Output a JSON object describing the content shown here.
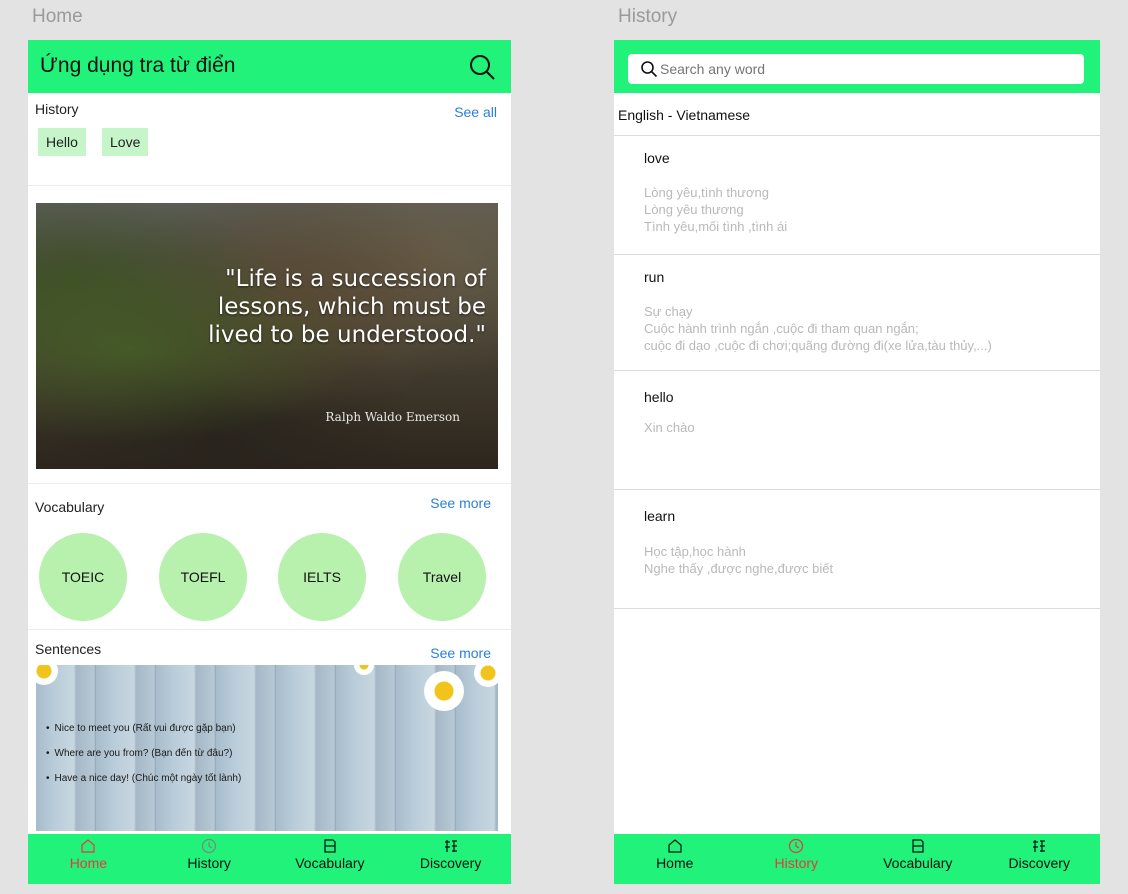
{
  "home": {
    "screen_label": "Home",
    "app_title": "Ứng dụng tra từ điển",
    "history": {
      "title": "History",
      "see_all": "See all",
      "chips": [
        "Hello",
        "Love"
      ]
    },
    "quote": {
      "text": "\"Life is a succession of lessons, which must be lived to be understood.\"",
      "author": "Ralph Waldo Emerson"
    },
    "vocabulary": {
      "title": "Vocabulary",
      "see_more": "See more",
      "items": [
        "TOEIC",
        "TOEFL",
        "IELTS",
        "Travel"
      ]
    },
    "sentences": {
      "title": "Sentences",
      "see_more": "See more",
      "items": [
        "Nice to meet you (Rất vui được gặp bạn)",
        "Where are you from? (Bạn đến từ đâu?)",
        "Have a nice day! (Chúc một ngày tốt lành)"
      ]
    }
  },
  "history_screen": {
    "screen_label": "History",
    "search_placeholder": "Search any word",
    "language": "English - Vietnamese",
    "entries": [
      {
        "word": "love",
        "defs": [
          "Lòng yêu,tình thương",
          "Lòng yêu thương",
          "Tình yêu,mối tình ,tình ái"
        ]
      },
      {
        "word": "run",
        "defs": [
          "Sự chạy",
          "Cuộc hành trình ngắn ,cuộc đi tham quan ngắn;",
          "cuộc đi dạo ,cuộc đi chơi;quãng đường đi(xe lửa,tàu thủy,...)"
        ]
      },
      {
        "word": "hello",
        "defs": [
          "Xin chào"
        ]
      },
      {
        "word": "learn",
        "defs": [
          "Học tập,học hành",
          "Nghe thấy ,được nghe,được biết"
        ]
      }
    ]
  },
  "nav": {
    "items": [
      "Home",
      "History",
      "Vocabulary",
      "Discovery"
    ],
    "icons": [
      "home-icon",
      "clock-icon",
      "book-icon",
      "discovery-icon"
    ]
  },
  "colors": {
    "accent_green": "#20f27a",
    "chip_green": "#c6f5ca",
    "circle_green": "#b7f1ad",
    "link_blue": "#2b7fd9",
    "active_red": "#e83a3a"
  }
}
